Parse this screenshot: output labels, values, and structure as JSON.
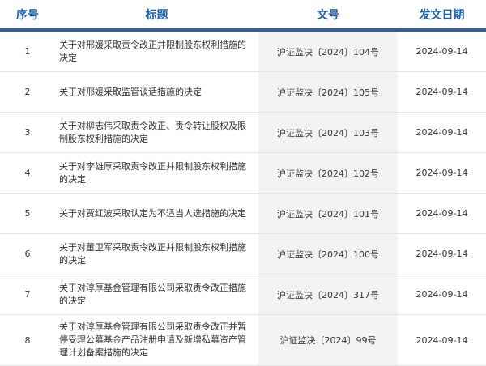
{
  "table": {
    "headers": {
      "no": "序号",
      "title": "标题",
      "doc_no": "文号",
      "date": "发文日期"
    },
    "rows": [
      {
        "no": "1",
        "title": "关于对邢媛采取责令改正并限制股东权利措施的决定",
        "doc_no": "沪证监决〔2024〕104号",
        "date": "2024-09-14"
      },
      {
        "no": "2",
        "title": "关于对邢媛采取监管谈话措施的决定",
        "doc_no": "沪证监决〔2024〕105号",
        "date": "2024-09-14"
      },
      {
        "no": "3",
        "title": "关于对柳志伟采取责令改正、责令转让股权及限制股东权利措施的决定",
        "doc_no": "沪证监决〔2024〕103号",
        "date": "2024-09-14"
      },
      {
        "no": "4",
        "title": "关于对李雄厚采取责令改正并限制股东权利措施的决定",
        "doc_no": "沪证监决〔2024〕102号",
        "date": "2024-09-14"
      },
      {
        "no": "5",
        "title": "关于对贾红波采取认定为不适当人选措施的决定",
        "doc_no": "沪证监决〔2024〕101号",
        "date": "2024-09-14"
      },
      {
        "no": "6",
        "title": "关于对董卫军采取责令改正并限制股东权利措施的决定",
        "doc_no": "沪证监决〔2024〕100号",
        "date": "2024-09-14"
      },
      {
        "no": "7",
        "title": "关于对淳厚基金管理有限公司采取责令改正措施的决定",
        "doc_no": "沪证监决〔2024〕317号",
        "date": "2024-09-14"
      },
      {
        "no": "8",
        "title": "关于对淳厚基金管理有限公司采取责令改正并暂停受理公募基金产品注册申请及新增私募资产管理计划备案措施的决定",
        "doc_no": "沪证监决〔2024〕99号",
        "date": "2024-09-14"
      }
    ]
  },
  "colors": {
    "header_text": "#1f5fa8",
    "header_rule": "#2f5f9e",
    "docno_bg": "#f3f3f3",
    "row_rule": "#e4e4e4"
  }
}
